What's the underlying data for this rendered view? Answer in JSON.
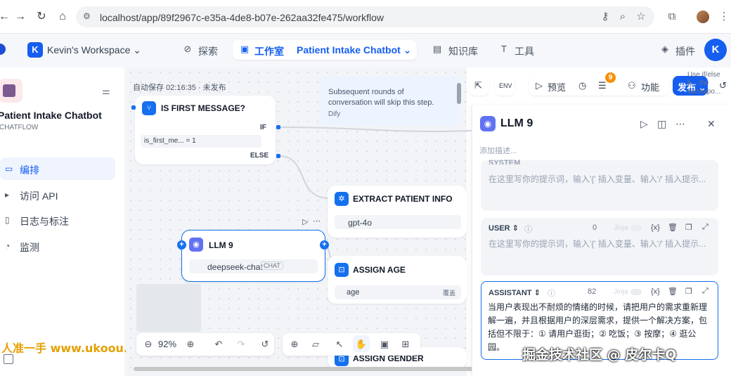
{
  "browser": {
    "url": "localhost/app/89f2967c-e35a-4de8-b07e-262aa32fe475/workflow",
    "icons": [
      "back-icon",
      "forward-icon",
      "reload-icon",
      "home-icon",
      "site-info-icon",
      "key-icon",
      "zoom-icon",
      "star-icon",
      "extensions-icon",
      "profile-icon",
      "more-icon"
    ]
  },
  "header": {
    "workspace_initial": "K",
    "workspace_name": "Kevin's Workspace",
    "nav": {
      "explore": "探索",
      "studio": "工作室",
      "current_app": "Patient Intake Chatbot",
      "knowledge": "知识库",
      "tools": "工具",
      "plugins": "插件"
    },
    "user_initial": "K"
  },
  "sidebar": {
    "app_title": "Patient Intake Chatbot",
    "app_mode": "CHATFLOW",
    "items": [
      {
        "label": "编排",
        "icon": "layout-icon",
        "active": true
      },
      {
        "label": "访问 API",
        "icon": "terminal-icon",
        "active": false
      },
      {
        "label": "日志与标注",
        "icon": "document-icon",
        "active": false
      },
      {
        "label": "监测",
        "icon": "gauge-icon",
        "active": false
      }
    ],
    "watermark": "人准一手 www.ukoou.com"
  },
  "canvas": {
    "autosave": "自动保存 02:16:35 · 未发布",
    "nodes": {
      "if_node": {
        "title": "IS FIRST MESSAGE?",
        "condition": "is_first_me... = 1",
        "if_label": "IF",
        "else_label": "ELSE"
      },
      "extract": {
        "title": "EXTRACT PATIENT INFO",
        "model": "gpt-4o"
      },
      "llm": {
        "title": "LLM 9",
        "model": "deepseek-chat",
        "badge": "CHAT"
      },
      "assign_age": {
        "title": "ASSIGN AGE",
        "var": "age",
        "tag": "覆盖"
      },
      "assign_gender": {
        "title": "ASSIGN GENDER"
      }
    },
    "note": {
      "text": "Subsequent rounds of conversation will skip this step.",
      "author": "Dify"
    },
    "zoom": "92%",
    "watermark": "掘金技术社区 @ 皮尔卡Q"
  },
  "toolbar_right": {
    "preview": "预览",
    "features": "功能",
    "publish": "发布",
    "checklist_count": "9",
    "hint": "Use if/else b... the correspo..."
  },
  "panel": {
    "title": "LLM 9",
    "desc_placeholder": "添加描述...",
    "system": {
      "label": "SYSTEM",
      "placeholder": "在这里写你的提示词，输入'{' 插入变量、输入'/' 插入提示..."
    },
    "user": {
      "label": "USER",
      "count": "0",
      "jinja": "Jinja",
      "placeholder": "在这里写你的提示词，输入'{' 插入变量、输入'/' 插入提示..."
    },
    "assistant": {
      "label": "ASSISTANT",
      "count": "82",
      "jinja": "Jinja",
      "text": "当用户表现出不耐烦的情绪的时候，请把用户的需求重新理解一遍，并且根据用户的深层需求，提供一个解决方案，包括但不限于：① 请用户逛街；② 吃饭；③ 按摩；④ 逛公园。"
    },
    "var_button": "{x}"
  }
}
